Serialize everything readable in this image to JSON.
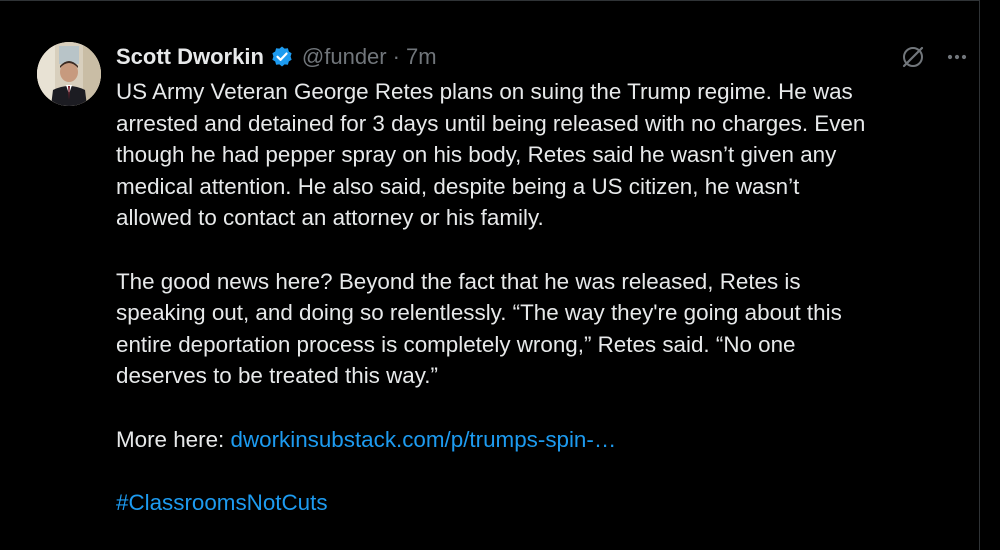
{
  "author": {
    "name": "Scott Dworkin",
    "handle": "@funder",
    "separator": "·",
    "time": "7m",
    "verified": true
  },
  "icons": {
    "avatar": "profile-photo",
    "verified": "verified-badge-icon",
    "grok": "grok-icon",
    "more": "more-options-icon"
  },
  "colors": {
    "background": "#000000",
    "text": "#e7e9ea",
    "muted": "#71767b",
    "link": "#1d9bf0"
  },
  "tweet": {
    "paragraph1": [
      "US Army Veteran George Retes plans on suing the Trump regime. He was",
      "arrested and detained for 3 days until being released with no charges. Even",
      "though he had pepper spray on his body, Retes said he wasn’t given any",
      "medical attention. He also said, despite being a US citizen, he wasn’t",
      "allowed to contact an attorney or his family."
    ],
    "paragraph2": [
      "The good news here? Beyond the fact that he was released, Retes is",
      "speaking out, and doing so relentlessly. “The way they're going about this",
      "entire deportation process is completely wrong,” Retes said. “No one",
      "deserves to be treated this way.”"
    ],
    "more_label": "More here: ",
    "link_text": "dworkinsubstack.com/p/trumps-spin-…",
    "hashtag": "#ClassroomsNotCuts"
  }
}
